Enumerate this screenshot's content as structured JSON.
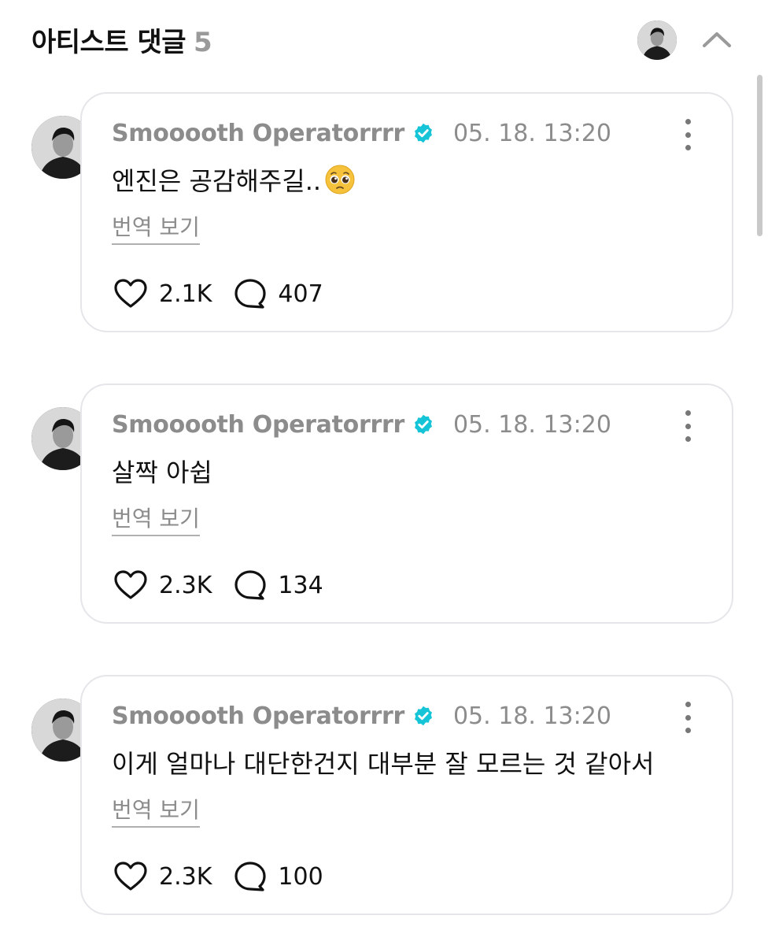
{
  "header": {
    "title": "아티스트 댓글",
    "count": "5"
  },
  "comments": [
    {
      "author": "Smooooth Operatorrrr",
      "time": "05. 18. 13:20",
      "text": "엔진은 공감해주길..",
      "emoji": "pleading-face-emoji",
      "translate": "번역 보기",
      "likes": "2.1K",
      "replies": "407"
    },
    {
      "author": "Smooooth Operatorrrr",
      "time": "05. 18. 13:20",
      "text": "살짝 아쉽",
      "translate": "번역 보기",
      "likes": "2.3K",
      "replies": "134"
    },
    {
      "author": "Smooooth Operatorrrr",
      "time": "05. 18. 13:20",
      "text": "이게 얼마나 대단한건지 대부분 잘 모르는 것 같아서",
      "translate": "번역 보기",
      "likes": "2.3K",
      "replies": "100"
    }
  ],
  "colors": {
    "verified": "#16c4d8",
    "muted_text": "#8c8c8c",
    "card_border": "#e6e6ea"
  },
  "icons": {
    "collapse": "chevron-up-icon",
    "more": "more-vertical-icon",
    "like": "heart-icon",
    "reply": "speech-bubble-icon",
    "verified": "verified-badge-icon"
  }
}
